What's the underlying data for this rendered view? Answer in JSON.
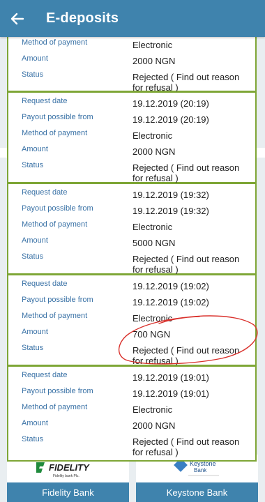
{
  "header": {
    "title": "E-deposits"
  },
  "labels": {
    "request_date": "Request date",
    "payout_from": "Payout possible from",
    "method": "Method of payment",
    "amount": "Amount",
    "status": "Status"
  },
  "deposits": [
    {
      "request_date": "",
      "payout_from": "",
      "method": "Electronic",
      "amount": "2000 NGN",
      "status": "Rejected ( Find out reason for refusal )"
    },
    {
      "request_date": "19.12.2019 (20:19)",
      "payout_from": "19.12.2019 (20:19)",
      "method": "Electronic",
      "amount": "2000 NGN",
      "status": "Rejected ( Find out reason for refusal )"
    },
    {
      "request_date": "19.12.2019 (19:32)",
      "payout_from": "19.12.2019 (19:32)",
      "method": "Electronic",
      "amount": "5000 NGN",
      "status": "Rejected ( Find out reason for refusal )"
    },
    {
      "request_date": "19.12.2019 (19:02)",
      "payout_from": "19.12.2019 (19:02)",
      "method": "Electronic",
      "amount": "700 NGN",
      "status": "Rejected ( Find out reason for refusal )"
    },
    {
      "request_date": "19.12.2019 (19:01)",
      "payout_from": "19.12.2019 (19:01)",
      "method": "Electronic",
      "amount": "2000 NGN",
      "status": "Rejected ( Find out reason for refusal )"
    }
  ],
  "banks": [
    {
      "name": "Fidelity Bank",
      "logo_text": "FIDELITY",
      "logo_sub": "Fidelity bank Plc."
    },
    {
      "name": "Keystone Bank",
      "logo_text": "Keystone",
      "logo_sub": "Bank"
    }
  ],
  "colors": {
    "accent": "#3f83ad",
    "card_border": "#7ea636",
    "label": "#3a72a6",
    "annotation": "#d9302b"
  }
}
